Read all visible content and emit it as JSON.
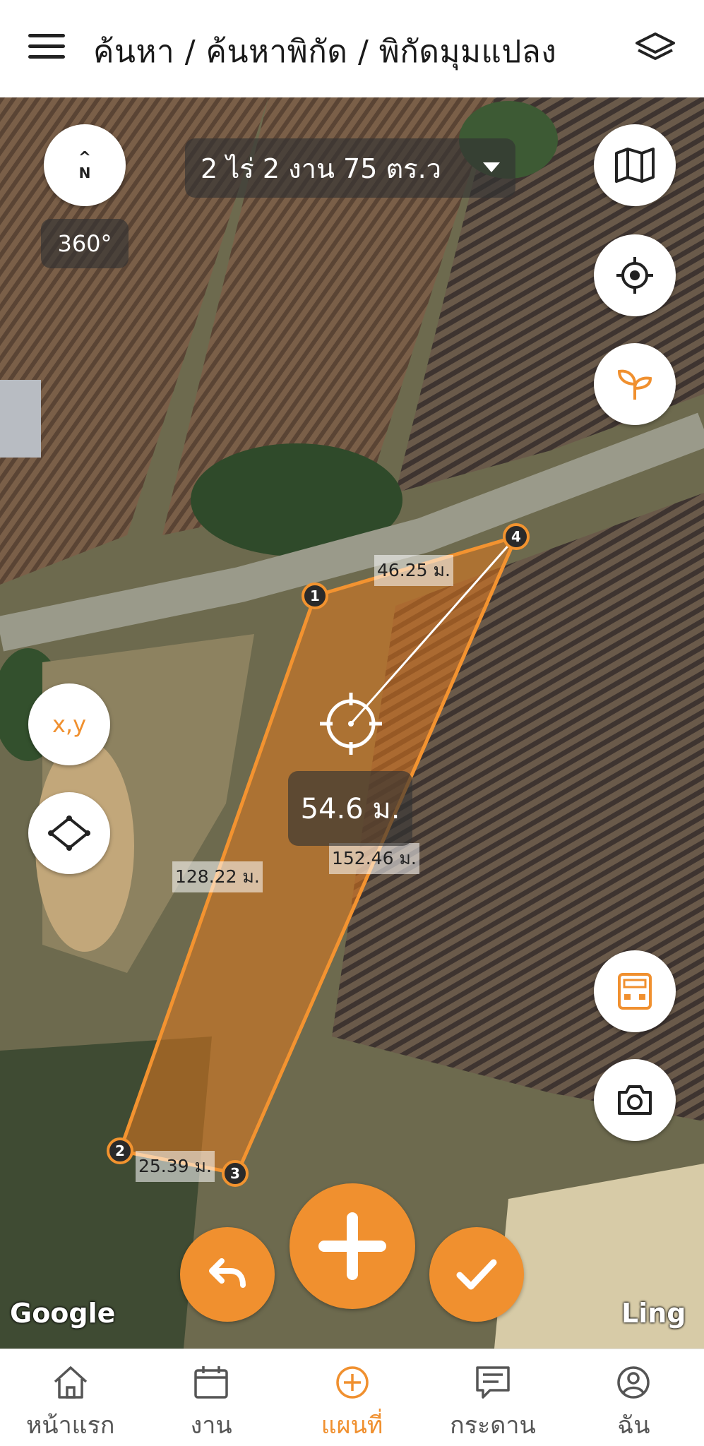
{
  "header": {
    "title": "ค้นหา / ค้นหาพิกัด / พิกัดมุมแปลง",
    "menu_icon": "hamburger-menu-icon",
    "layers_icon": "layers-icon"
  },
  "map": {
    "compass": {
      "label": "N",
      "heading": "360°"
    },
    "area_selector": {
      "label": "2 ไร่ 2 งาน 75 ตร.ว",
      "icon": "dropdown-arrow-icon"
    },
    "distance_readout": "54.6 ม.",
    "edges": [
      "46.25 ม.",
      "128.22 ม.",
      "152.46 ม.",
      "25.39 ม."
    ],
    "vertices": [
      "1",
      "2",
      "3",
      "4"
    ],
    "side_buttons": {
      "map_type_icon": "map-icon",
      "locate_icon": "crosshair-location-icon",
      "plant_icon": "sprout-icon",
      "xy_label": "x,y",
      "polygon_icon": "polygon-shape-icon",
      "calculator_icon": "calculator-icon",
      "camera_icon": "camera-icon"
    },
    "attribution": "Google",
    "watermark_right": "Ling",
    "accent_color": "#f0902f"
  },
  "bottom_nav": {
    "items": [
      {
        "label": "หน้าแรก",
        "icon": "home-icon"
      },
      {
        "label": "งาน",
        "icon": "calendar-icon"
      },
      {
        "label": "แผนที่",
        "icon": "add-circle-icon",
        "active": true
      },
      {
        "label": "กระดาน",
        "icon": "board-icon"
      },
      {
        "label": "ฉัน",
        "icon": "user-profile-icon"
      }
    ]
  }
}
